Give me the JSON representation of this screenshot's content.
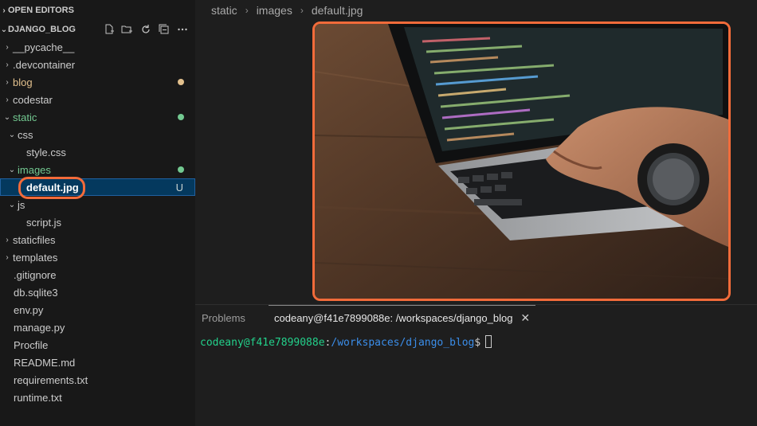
{
  "explorer": {
    "open_editors": "OPEN EDITORS",
    "project": "DJANGO_BLOG",
    "tree": [
      {
        "label": "__pycache__",
        "kind": "folder",
        "expanded": false,
        "indent": 0
      },
      {
        "label": ".devcontainer",
        "kind": "folder",
        "expanded": false,
        "indent": 0
      },
      {
        "label": "blog",
        "kind": "folder",
        "expanded": false,
        "indent": 0,
        "status": "modified"
      },
      {
        "label": "codestar",
        "kind": "folder",
        "expanded": false,
        "indent": 0
      },
      {
        "label": "static",
        "kind": "folder",
        "expanded": true,
        "indent": 0,
        "status": "new"
      },
      {
        "label": "css",
        "kind": "folder",
        "expanded": true,
        "indent": 1
      },
      {
        "label": "style.css",
        "kind": "file",
        "indent": 2
      },
      {
        "label": "images",
        "kind": "folder",
        "expanded": true,
        "indent": 1,
        "status": "new"
      },
      {
        "label": "default.jpg",
        "kind": "file",
        "indent": 2,
        "selected": true,
        "badge": "U"
      },
      {
        "label": "js",
        "kind": "folder",
        "expanded": true,
        "indent": 1
      },
      {
        "label": "script.js",
        "kind": "file",
        "indent": 2
      },
      {
        "label": "staticfiles",
        "kind": "folder",
        "expanded": false,
        "indent": 0
      },
      {
        "label": "templates",
        "kind": "folder",
        "expanded": false,
        "indent": 0
      },
      {
        "label": ".gitignore",
        "kind": "file",
        "indent": 0
      },
      {
        "label": "db.sqlite3",
        "kind": "file",
        "indent": 0
      },
      {
        "label": "env.py",
        "kind": "file",
        "indent": 0
      },
      {
        "label": "manage.py",
        "kind": "file",
        "indent": 0
      },
      {
        "label": "Procfile",
        "kind": "file",
        "indent": 0
      },
      {
        "label": "README.md",
        "kind": "file",
        "indent": 0
      },
      {
        "label": "requirements.txt",
        "kind": "file",
        "indent": 0
      },
      {
        "label": "runtime.txt",
        "kind": "file",
        "indent": 0
      }
    ],
    "actions": [
      "new-file-icon",
      "new-folder-icon",
      "refresh-icon",
      "collapse-all-icon",
      "more-icon"
    ]
  },
  "breadcrumb": [
    "static",
    "images",
    "default.jpg"
  ],
  "panel": {
    "problems_label": "Problems",
    "terminal_tab": "codeany@f41e7899088e: /workspaces/django_blog",
    "prompt_user": "codeany@f41e7899088e",
    "prompt_colon": ":",
    "prompt_path": "/workspaces/django_blog",
    "prompt_symbol": "$"
  },
  "colors": {
    "highlight": "#f26b3a",
    "modified": "#e2c08d",
    "untracked": "#73c991",
    "selection": "#04395e"
  }
}
